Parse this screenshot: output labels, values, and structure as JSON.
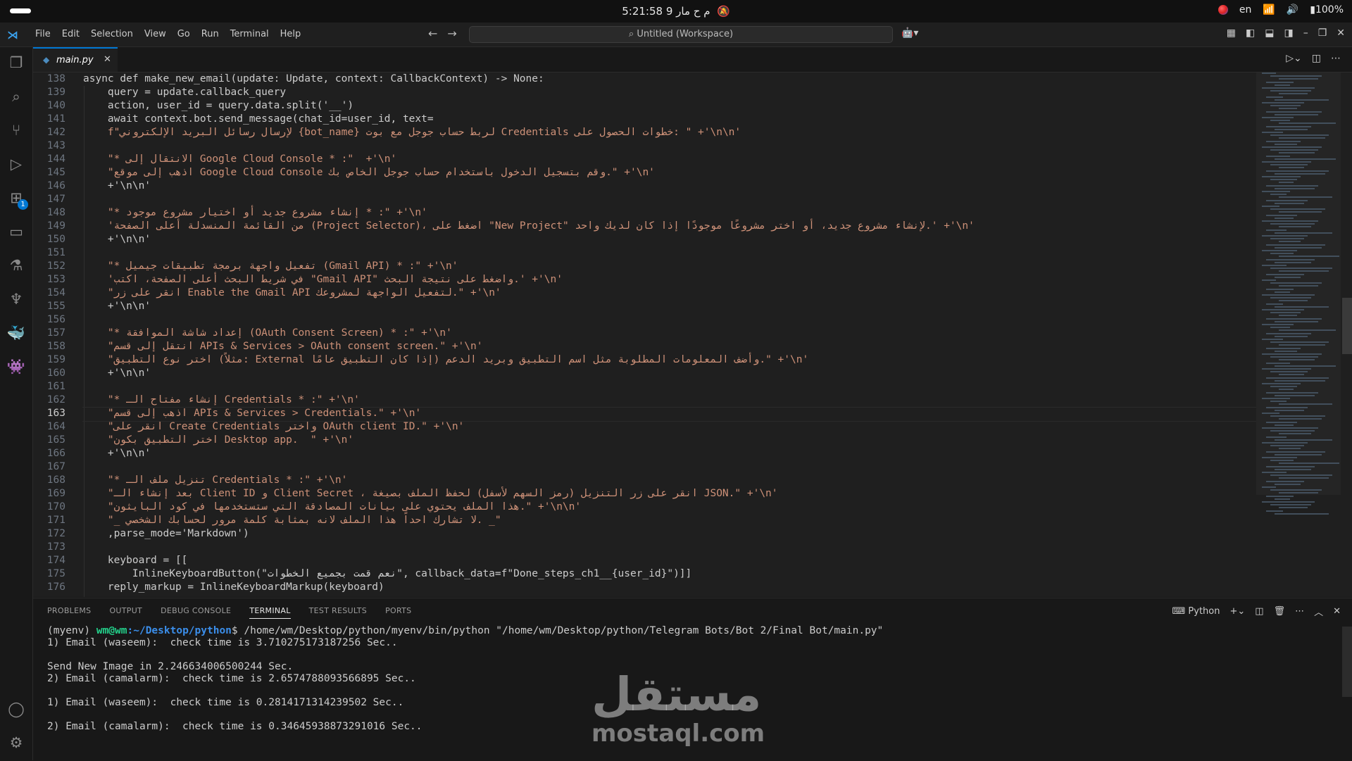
{
  "os_bar": {
    "clock": "5:21:58 م   ح مار 9",
    "bell_icon": "notification-off-icon",
    "language": "en",
    "battery": "100%"
  },
  "titlebar": {
    "menu": [
      "File",
      "Edit",
      "Selection",
      "View",
      "Go",
      "Run",
      "Terminal",
      "Help"
    ],
    "search": "Untitled (Workspace)"
  },
  "activity": {
    "icons": [
      "files-icon",
      "search-icon",
      "source-control-icon",
      "run-debug-icon",
      "extensions-icon",
      "remote-explorer-icon",
      "testing-icon",
      "python-icon",
      "docker-icon",
      "alien-icon"
    ],
    "extensions_badge": "1",
    "bottom_icons": [
      "account-icon",
      "settings-gear-icon"
    ]
  },
  "tab": {
    "name": "main.py",
    "close": "✕"
  },
  "editor": {
    "current_line": 163,
    "lines": [
      {
        "n": 138,
        "t": "async def make_new_email(update: Update, context: CallbackContext) -> None:"
      },
      {
        "n": 139,
        "t": "    query = update.callback_query"
      },
      {
        "n": 140,
        "t": "    action, user_id = query.data.split('__')"
      },
      {
        "n": 141,
        "t": "    await context.bot.send_message(chat_id=user_id, text="
      },
      {
        "n": 142,
        "t": "    f\"لإرسال رسائل البريد الإلكتروني {bot_name} لربط حساب جوجل مع بوت Credentials خطوات الحصول على: \" +'\\n\\n'"
      },
      {
        "n": 143,
        "t": ""
      },
      {
        "n": 144,
        "t": "    \"* الانتقال إلى Google Cloud Console * :\"  +'\\n'"
      },
      {
        "n": 145,
        "t": "    \"اذهب إلى موقع Google Cloud Console وقم بتسجيل الدخول باستخدام حساب جوجل الخاص بك.\" +'\\n'"
      },
      {
        "n": 146,
        "t": "    +'\\n\\n'"
      },
      {
        "n": 147,
        "t": ""
      },
      {
        "n": 148,
        "t": "    \"* إنشاء مشروع جديد أو اختيار مشروع موجود * :\" +'\\n'"
      },
      {
        "n": 149,
        "t": "    'من القائمة المنسدلة أعلى الصفحة (Project Selector)، اضغط على \"New Project\" لإنشاء مشروع جديد، أو اختر مشروعًا موجودًا إذا كان لديك واحد.' +'\\n'"
      },
      {
        "n": 150,
        "t": "    +'\\n\\n'"
      },
      {
        "n": 151,
        "t": ""
      },
      {
        "n": 152,
        "t": "    \"* تفعيل واجهة برمجة تطبيقات جيميل (Gmail API) * :\" +'\\n'"
      },
      {
        "n": 153,
        "t": "    'في شريط البحث أعلى الصفحة، اكتب \"Gmail API\" واضغط على نتيجة البحث.' +'\\n'"
      },
      {
        "n": 154,
        "t": "    \"انقر على زر Enable the Gmail API لتفعيل الواجهة لمشروعك.\" +'\\n'"
      },
      {
        "n": 155,
        "t": "    +'\\n\\n'"
      },
      {
        "n": 156,
        "t": ""
      },
      {
        "n": 157,
        "t": "    \"* إعداد شاشة الموافقة (OAuth Consent Screen) * :\" +'\\n'"
      },
      {
        "n": 158,
        "t": "    \"انتقل إلى قسم APIs & Services > OAuth consent screen.\" +'\\n'"
      },
      {
        "n": 159,
        "t": "    \"اختر نوع التطبيق (مثلاً: External إذا كان التطبيق عامًا) وأضف المعلومات المطلوبة مثل اسم التطبيق وبريد الدعم.\" +'\\n'"
      },
      {
        "n": 160,
        "t": "    +'\\n\\n'"
      },
      {
        "n": 161,
        "t": ""
      },
      {
        "n": 162,
        "t": "    \"* إنشاء مفتاح الـ Credentials * :\" +'\\n'"
      },
      {
        "n": 163,
        "t": "    \"اذهب إلى قسم APIs & Services > Credentials.\" +'\\n'"
      },
      {
        "n": 164,
        "t": "    \"انقر على Create Credentials واختر OAuth client ID.\" +'\\n'"
      },
      {
        "n": 165,
        "t": "    \"اختر التطبيق بكون Desktop app.  \" +'\\n'"
      },
      {
        "n": 166,
        "t": "    +'\\n\\n'"
      },
      {
        "n": 167,
        "t": ""
      },
      {
        "n": 168,
        "t": "    \"* تنزيل ملف الـ Credentials * :\" +'\\n'"
      },
      {
        "n": 169,
        "t": "    \"بعد إنشاء الـ Client ID و Client Secret ، انقر على زر التنزيل (رمز السهم لأسفل) لحفظ الملف بصيغة JSON.\" +'\\n'"
      },
      {
        "n": 170,
        "t": "    \"هذا الملف يحتوي على بيانات المصادقة التي ستستخدمها في كود البايثون.\" +'\\n\\n'"
      },
      {
        "n": 171,
        "t": "    \"_ لا تشارك احداً هذا الملف لانه بمثابة كلمة مرور لحسابك الشخصي. _\""
      },
      {
        "n": 172,
        "t": "    ,parse_mode='Markdown')"
      },
      {
        "n": 173,
        "t": ""
      },
      {
        "n": 174,
        "t": "    keyboard = [["
      },
      {
        "n": 175,
        "t": "        InlineKeyboardButton(\"نعم قمت بجميع الخطوات\", callback_data=f\"Done_steps_ch1__{user_id}\")]]"
      },
      {
        "n": 176,
        "t": "    reply_markup = InlineKeyboardMarkup(keyboard)"
      }
    ]
  },
  "panel": {
    "tabs": [
      "PROBLEMS",
      "OUTPUT",
      "DEBUG CONSOLE",
      "TERMINAL",
      "TEST RESULTS",
      "PORTS"
    ],
    "active_tab": "TERMINAL",
    "shell": "Python",
    "prompt_env": "(myenv) ",
    "prompt_user": "wm@wm",
    "prompt_path": ":~/Desktop/python",
    "prompt_cmd": "$ /home/wm/Desktop/python/myenv/bin/python \"/home/wm/Desktop/python/Telegram Bots/Bot 2/Final Bot/main.py\"",
    "output": [
      "1) Email (waseem):  check time is 3.710275173187256 Sec..",
      "",
      "Send New Image in 2.246634006500244 Sec.",
      "2) Email (camalarm):  check time is 2.6574788093566895 Sec..",
      "",
      "1) Email (waseem):  check time is 0.2814171314239502 Sec..",
      "",
      "2) Email (camalarm):  check time is 0.34645938873291016 Sec.."
    ]
  },
  "watermark": {
    "arabic": "مستقل",
    "latin": "mostaql.com"
  }
}
